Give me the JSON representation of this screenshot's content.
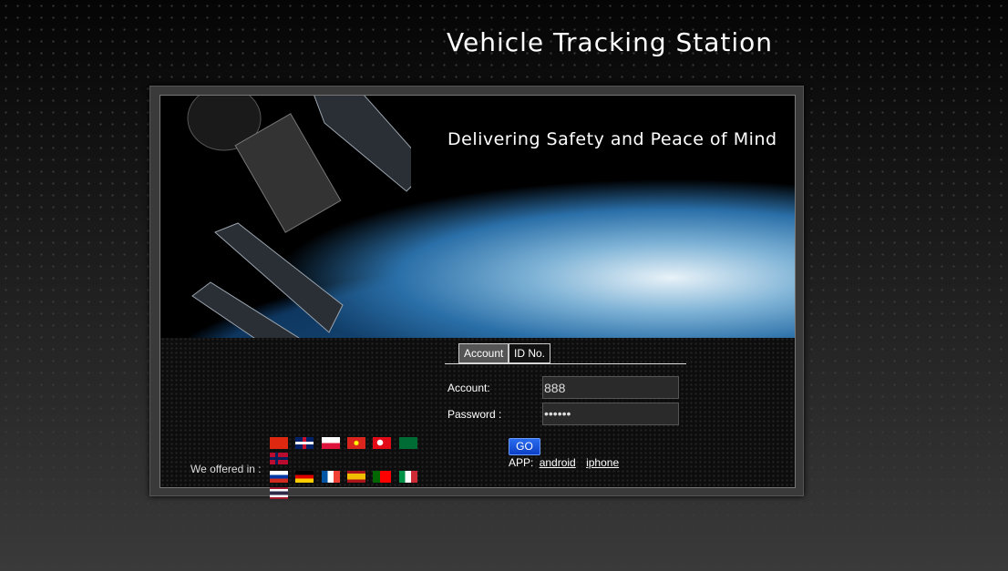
{
  "header": {
    "title": "Vehicle Tracking Station"
  },
  "hero": {
    "tagline": "Delivering Safety and Peace of Mind"
  },
  "login": {
    "tabs": [
      {
        "label": "Account",
        "active": true
      },
      {
        "label": "ID No.",
        "active": false
      }
    ],
    "account_label": "Account:",
    "account_value": "888",
    "password_label": "Password :",
    "password_value": "••••••",
    "go_label": "GO",
    "app_label": "APP:",
    "android_link": "android",
    "iphone_link": "iphone"
  },
  "languages": {
    "label": "We offered in :",
    "flags": [
      "china",
      "united-kingdom",
      "poland",
      "vietnam",
      "turkey",
      "saudi-arabia",
      "norway",
      "russia",
      "germany",
      "france",
      "spain",
      "portugal",
      "italy",
      "thailand"
    ]
  }
}
